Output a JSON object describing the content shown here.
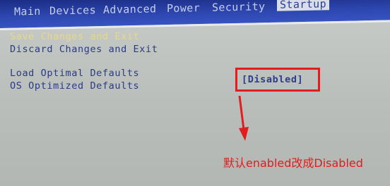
{
  "menubar": {
    "tabs": [
      "Main",
      "Devices",
      "Advanced",
      "Power",
      "Security",
      "Startup"
    ]
  },
  "exit_menu": {
    "items": [
      {
        "label": "Save Changes and Exit",
        "highlighted": true
      },
      {
        "label": "Discard Changes and Exit",
        "highlighted": false
      },
      {
        "label": "Load Optimal Defaults",
        "highlighted": false
      },
      {
        "label": "OS Optimized Defaults",
        "highlighted": false
      }
    ],
    "os_optimized_value": "[Disabled]"
  },
  "annotation": {
    "note": "默认enabled改成Disabled",
    "color": "#e31b1b"
  },
  "colors": {
    "menubar": "#2e47b0",
    "text": "#2a3a8a",
    "highlight": "#e7d78a",
    "background": "#c2c6c3"
  }
}
